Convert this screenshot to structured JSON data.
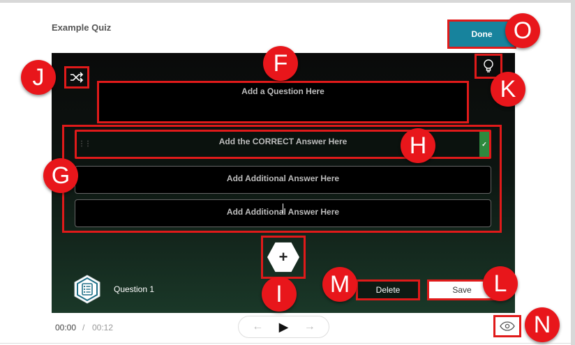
{
  "header": {
    "title": "Example Quiz",
    "done_label": "Done"
  },
  "question": {
    "placeholder": "Add a Question Here"
  },
  "answers": [
    {
      "text": "Add the CORRECT Answer Here",
      "correct": true
    },
    {
      "text": "Add Additional Answer Here",
      "correct": false
    },
    {
      "text": "Add Additional Answer Here",
      "correct": false
    }
  ],
  "footer": {
    "question_label": "Question 1",
    "delete_label": "Delete",
    "save_label": "Save",
    "time_current": "00:00",
    "time_separator": "/",
    "time_total": "00:12"
  },
  "controls": {
    "add_symbol": "+",
    "prev_symbol": "←",
    "play_symbol": "▶",
    "next_symbol": "→",
    "check_symbol": "✓",
    "drag_symbol": "⋮⋮"
  },
  "callouts": {
    "F": "F",
    "G": "G",
    "H": "H",
    "I": "I",
    "J": "J",
    "K": "K",
    "L": "L",
    "M": "M",
    "N": "N",
    "O": "O"
  },
  "icons": [
    "shuffle-icon",
    "lightbulb-icon",
    "plus-icon",
    "quiz-question-icon",
    "eye-icon",
    "play-icon",
    "arrow-left-icon",
    "arrow-right-icon"
  ],
  "colors": {
    "annotation_red": "#e01a1a",
    "callout_red": "#e8161b",
    "done_teal": "#17839d",
    "correct_green": "#2f8a3e"
  }
}
